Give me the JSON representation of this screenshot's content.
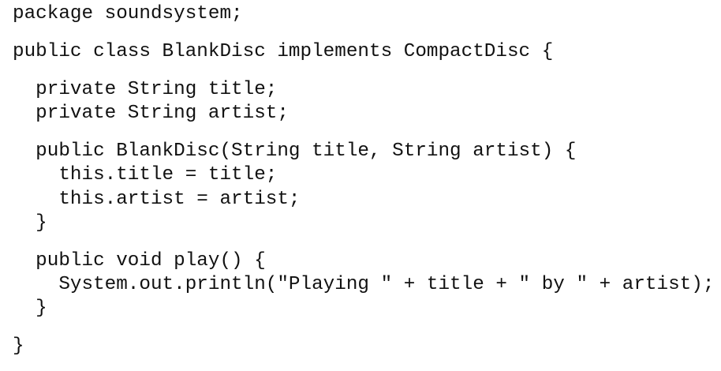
{
  "code": {
    "lines": [
      "package soundsystem;",
      "public class BlankDisc implements CompactDisc {",
      "  private String title;",
      "  private String artist;",
      "  public BlankDisc(String title, String artist) {",
      "    this.title = title;",
      "    this.artist = artist;",
      "  }",
      "  public void play() {",
      "    System.out.println(\"Playing \" + title + \" by \" + artist);",
      "  }",
      "}"
    ]
  }
}
